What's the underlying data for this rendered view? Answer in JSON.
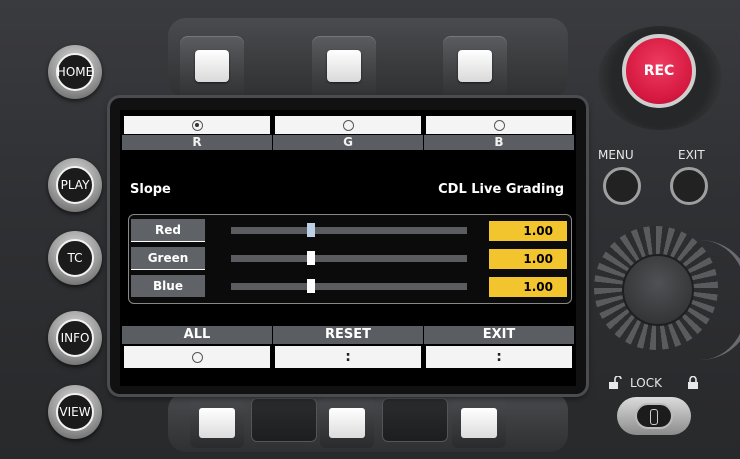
{
  "side_buttons": [
    "HOME",
    "PLAY",
    "TC",
    "INFO",
    "VIEW"
  ],
  "top_tabs": [
    {
      "label": "R",
      "selected": true
    },
    {
      "label": "G",
      "selected": false
    },
    {
      "label": "B",
      "selected": false
    }
  ],
  "screen": {
    "title_left": "Slope",
    "title_right": "CDL Live Grading",
    "rows": [
      {
        "label": "Red",
        "value": "1.00",
        "level": 0.34
      },
      {
        "label": "Green",
        "value": "1.00",
        "level": 0.34
      },
      {
        "label": "Blue",
        "value": "1.00",
        "level": 0.34
      }
    ]
  },
  "bottom_tabs": [
    {
      "label": "ALL",
      "control": "radio"
    },
    {
      "label": "RESET",
      "control": ":"
    },
    {
      "label": "EXIT",
      "control": ":"
    }
  ],
  "right_panel": {
    "rec_label": "REC",
    "menu_label": "MENU",
    "exit_label": "EXIT",
    "lock_label": "LOCK"
  },
  "colors": {
    "rec": "#d4173e",
    "value_box": "#f2c42e",
    "tab_label_bg": "#5a5d62"
  },
  "icons": [
    "unlock-icon",
    "lock-icon"
  ]
}
